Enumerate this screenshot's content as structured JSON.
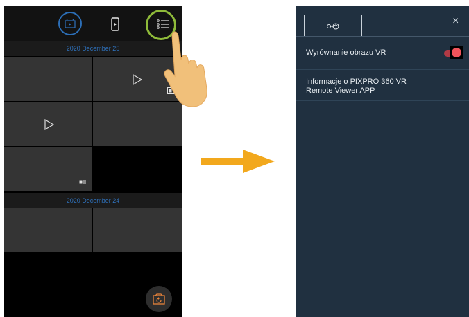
{
  "left_screen": {
    "groups": [
      {
        "date": "2020 December 25"
      },
      {
        "date": "2020 December 24"
      }
    ]
  },
  "right_panel": {
    "close_glyph": "×",
    "settings": [
      {
        "label": "Wyrównanie obrazu VR",
        "toggle_on": true
      },
      {
        "label_line1": "Informacje o PIXPRO 360 VR",
        "label_line2": "Remote Viewer APP"
      }
    ]
  },
  "colors": {
    "accent_blue": "#2f73bf",
    "highlight_green": "#8fbb3a",
    "arrow_orange": "#f2a81d",
    "toggle_red": "#f2545b",
    "panel_bg": "#203040"
  }
}
